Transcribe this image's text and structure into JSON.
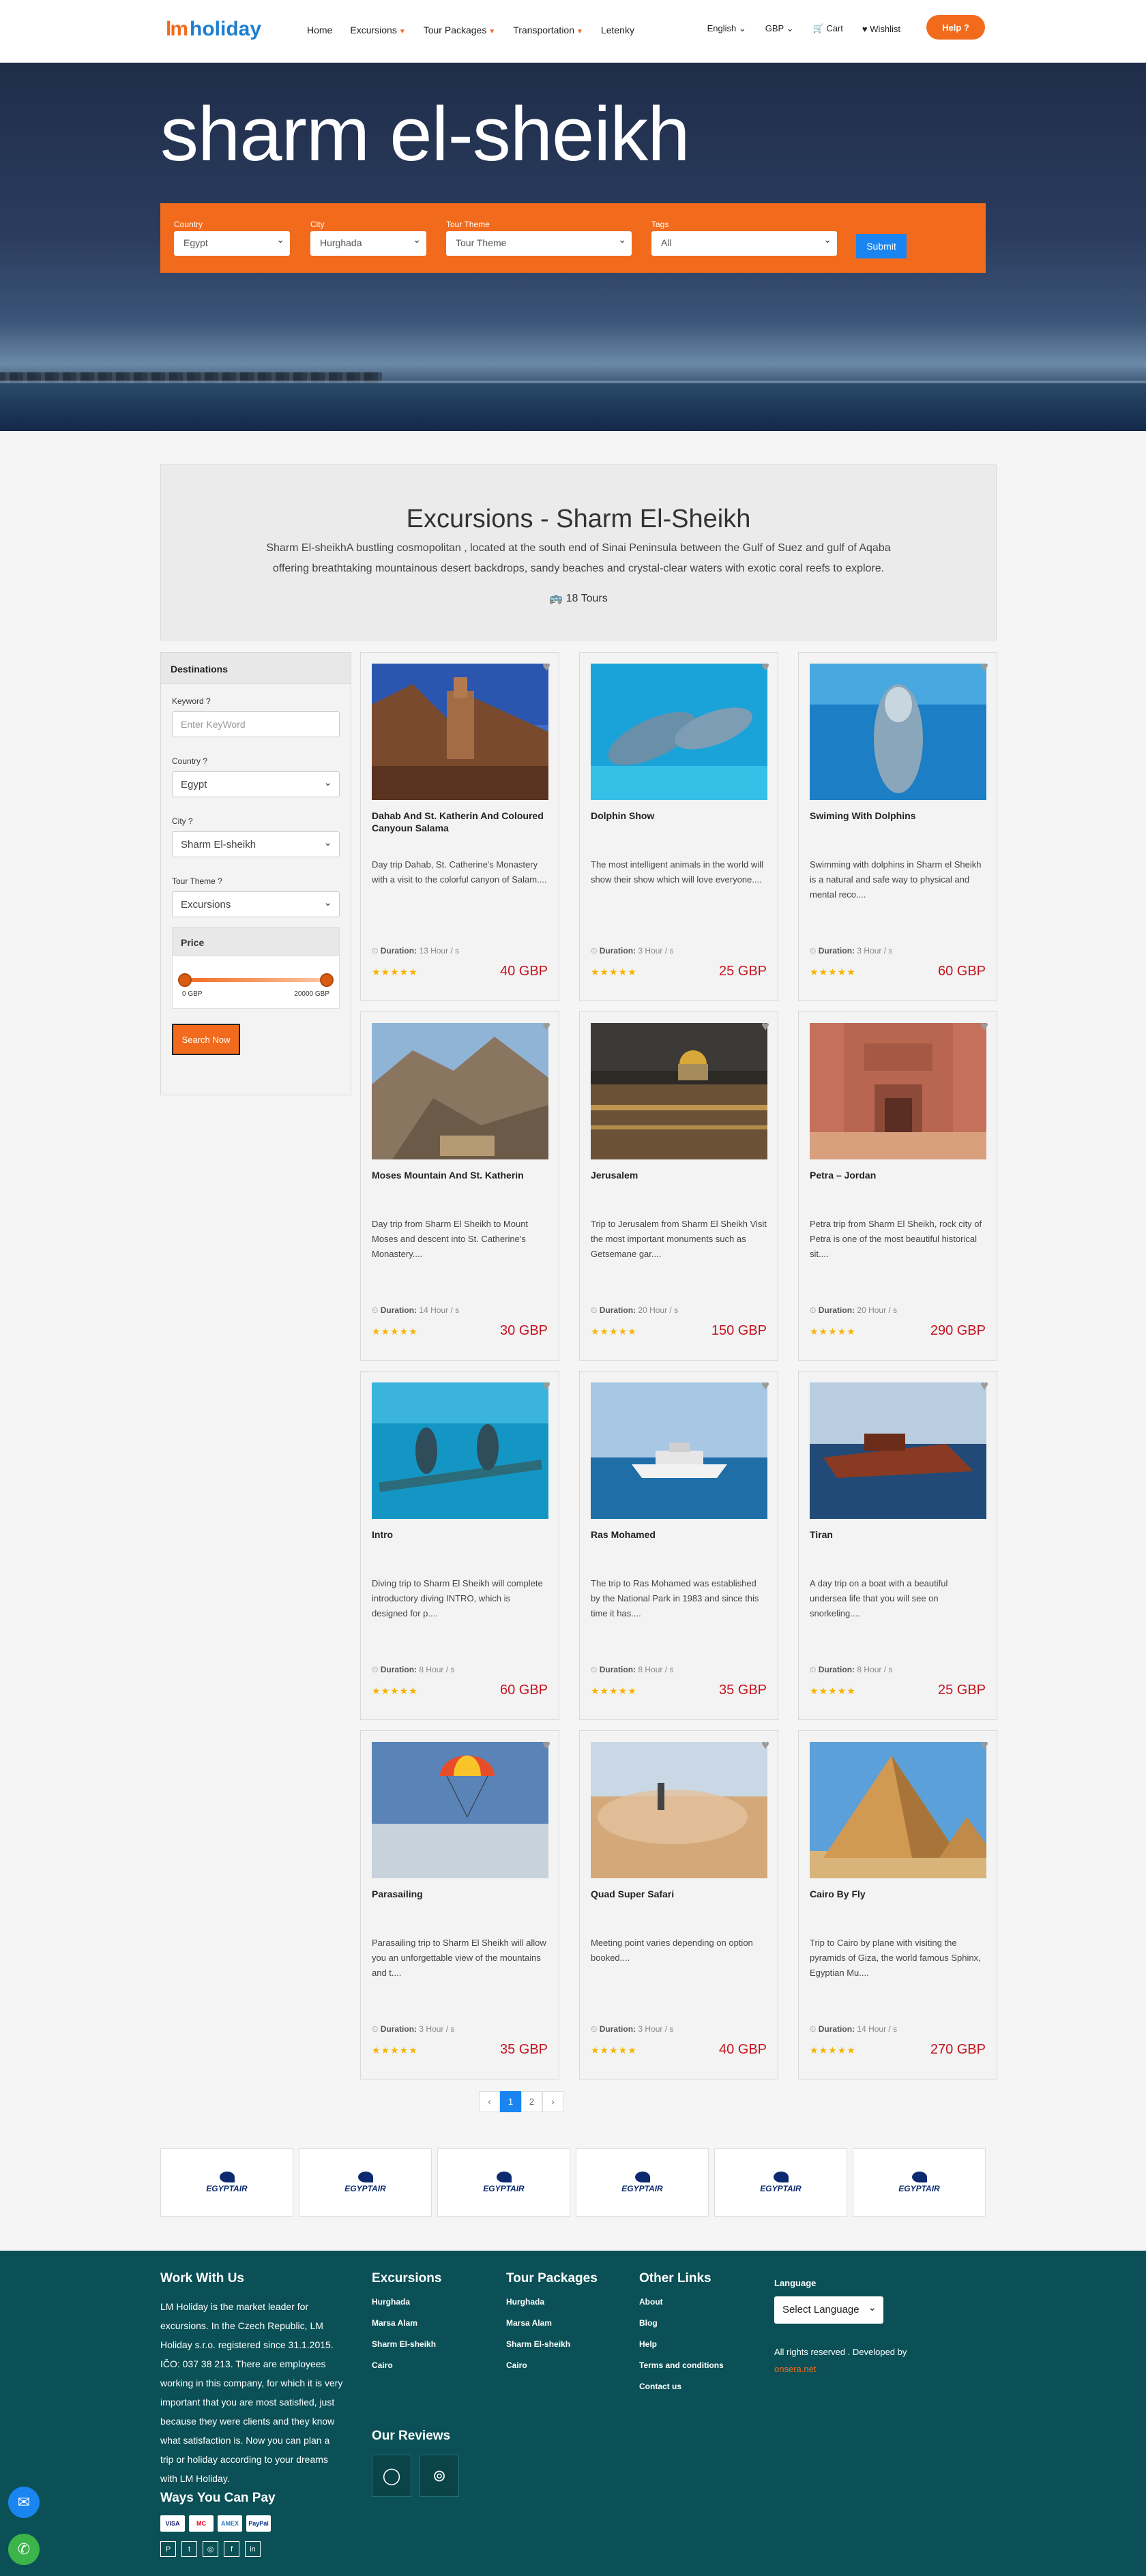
{
  "header": {
    "logo_mark": "lm",
    "logo_text": "holiday",
    "nav": [
      {
        "label": "Home",
        "caret": false
      },
      {
        "label": "Excursions",
        "caret": true
      },
      {
        "label": "Tour Packages",
        "caret": true
      },
      {
        "label": "Transportation",
        "caret": true
      },
      {
        "label": "Letenky",
        "caret": false
      }
    ],
    "language": "English",
    "currency": "GBP",
    "cart": "Cart",
    "wishlist": "Wishlist",
    "help": "Help"
  },
  "hero": {
    "title": "sharm el-sheikh",
    "filters": {
      "country_label": "Country",
      "country_value": "Egypt",
      "city_label": "City",
      "city_value": "Hurghada",
      "theme_label": "Tour Theme",
      "theme_value": "Tour Theme",
      "tags_label": "Tags",
      "tags_value": "All",
      "submit": "Submit"
    }
  },
  "intro": {
    "title": "Excursions - Sharm El-Sheikh",
    "description": "Sharm El-sheikhA bustling cosmopolitan , located at the south end of Sinai Peninsula between the Gulf of Suez and gulf of Aqaba offering breathtaking mountainous desert backdrops, sandy beaches and crystal-clear waters with exotic coral reefs to explore.",
    "count": "18 Tours"
  },
  "sidebar": {
    "title": "Destinations",
    "keyword_label": "Keyword ?",
    "keyword_placeholder": "Enter KeyWord",
    "country_label": "Country ?",
    "country_value": "Egypt",
    "city_label": "City ?",
    "city_value": "Sharm El-sheikh",
    "theme_label": "Tour Theme ?",
    "theme_value": "Excursions",
    "price_title": "Price",
    "price_min": "0 GBP",
    "price_max": "20000 GBP",
    "search": "Search Now"
  },
  "tours": [
    {
      "title": "Dahab And St. Katherin And Coloured Canyoun Salama",
      "desc": "Day trip Dahab, St. Catherine's Monastery with a visit to the colorful canyon of Salam....",
      "duration_label": "Duration:",
      "duration": "13 Hour / s",
      "stars": "★★★★★",
      "price": "40 GBP"
    },
    {
      "title": "Dolphin Show",
      "desc": "The most intelligent animals in the world will show their show which will love everyone....",
      "duration_label": "Duration:",
      "duration": "3 Hour / s",
      "stars": "★★★★★",
      "price": "25 GBP"
    },
    {
      "title": "Swiming With Dolphins",
      "desc": "Swimming with dolphins in Sharm el Sheikh is a natural and safe way to physical and mental reco....",
      "duration_label": "Duration:",
      "duration": "3 Hour / s",
      "stars": "★★★★★",
      "price": "60 GBP"
    },
    {
      "title": "Moses Mountain And St. Katherin",
      "desc": "Day trip from Sharm El Sheikh to Mount Moses and descent into St. Catherine's Monastery....",
      "duration_label": "Duration:",
      "duration": "14 Hour / s",
      "stars": "★★★★★",
      "price": "30 GBP"
    },
    {
      "title": "Jerusalem",
      "desc": "Trip to Jerusalem from Sharm El Sheikh Visit the most important monuments such as Getsemane gar....",
      "duration_label": "Duration:",
      "duration": "20 Hour / s",
      "stars": "★★★★★",
      "price": "150 GBP"
    },
    {
      "title": "Petra – Jordan",
      "desc": "Petra trip from Sharm El Sheikh, rock city of Petra is one of the most beautiful historical sit....",
      "duration_label": "Duration:",
      "duration": "20 Hour / s",
      "stars": "★★★★★",
      "price": "290 GBP"
    },
    {
      "title": "Intro",
      "desc": "Diving trip to Sharm El Sheikh will complete introductory diving INTRO, which is designed for p....",
      "duration_label": "Duration:",
      "duration": "8 Hour / s",
      "stars": "★★★★★",
      "price": "60 GBP"
    },
    {
      "title": "Ras Mohamed",
      "desc": "The trip to Ras Mohamed was established by the National Park in 1983 and since this time it has....",
      "duration_label": "Duration:",
      "duration": "8 Hour / s",
      "stars": "★★★★★",
      "price": "35 GBP"
    },
    {
      "title": "Tiran",
      "desc": "A day trip on a boat with a beautiful undersea life that you will see on snorkeling....",
      "duration_label": "Duration:",
      "duration": "8 Hour / s",
      "stars": "★★★★★",
      "price": "25 GBP"
    },
    {
      "title": "Parasailing",
      "desc": "Parasailing trip to Sharm El Sheikh will allow you an unforgettable view of the mountains and t....",
      "duration_label": "Duration:",
      "duration": "3 Hour / s",
      "stars": "★★★★★",
      "price": "35 GBP"
    },
    {
      "title": "Quad Super Safari",
      "desc": "Meeting point varies depending on option booked....",
      "duration_label": "Duration:",
      "duration": "3 Hour / s",
      "stars": "★★★★★",
      "price": "40 GBP"
    },
    {
      "title": "Cairo By Fly",
      "desc": "Trip to Cairo by plane with visiting the pyramids of Giza, the world famous Sphinx, Egyptian Mu....",
      "duration_label": "Duration:",
      "duration": "14 Hour / s",
      "stars": "★★★★★",
      "price": "270 GBP"
    }
  ],
  "pagination": {
    "prev": "‹",
    "pages": [
      "1",
      "2"
    ],
    "next": "›"
  },
  "partners": {
    "name": "EGYPTAIR"
  },
  "footer": {
    "work_title": "Work With Us",
    "work_text": "LM Holiday is the market leader for excursions. In the Czech Republic, LM Holiday s.r.o. registered since 31.1.2015. IČO: 037 38 213. There are employees working in this company, for which it is very important that you are most satisfied, just because they were clients and they know what satisfaction is. Now you can plan a trip or holiday according to your dreams with LM Holiday.",
    "pay_title": "Ways You Can Pay",
    "pay_methods": [
      "VISA",
      "MC",
      "AMEX",
      "PayPal"
    ],
    "excursions_title": "Excursions",
    "excursions": [
      "Hurghada",
      "Marsa Alam",
      "Sharm El-sheikh",
      "Cairo"
    ],
    "packages_title": "Tour Packages",
    "packages": [
      "Hurghada",
      "Marsa Alam",
      "Sharm El-sheikh",
      "Cairo"
    ],
    "other_title": "Other Links",
    "other": [
      "About",
      "Blog",
      "Help",
      "Terms and conditions",
      "Contact us"
    ],
    "reviews_title": "Our Reviews",
    "language_title": "Language",
    "language_select": "Select Language",
    "rights": "All rights reserved . Developed by",
    "developer": "onsera.net"
  }
}
